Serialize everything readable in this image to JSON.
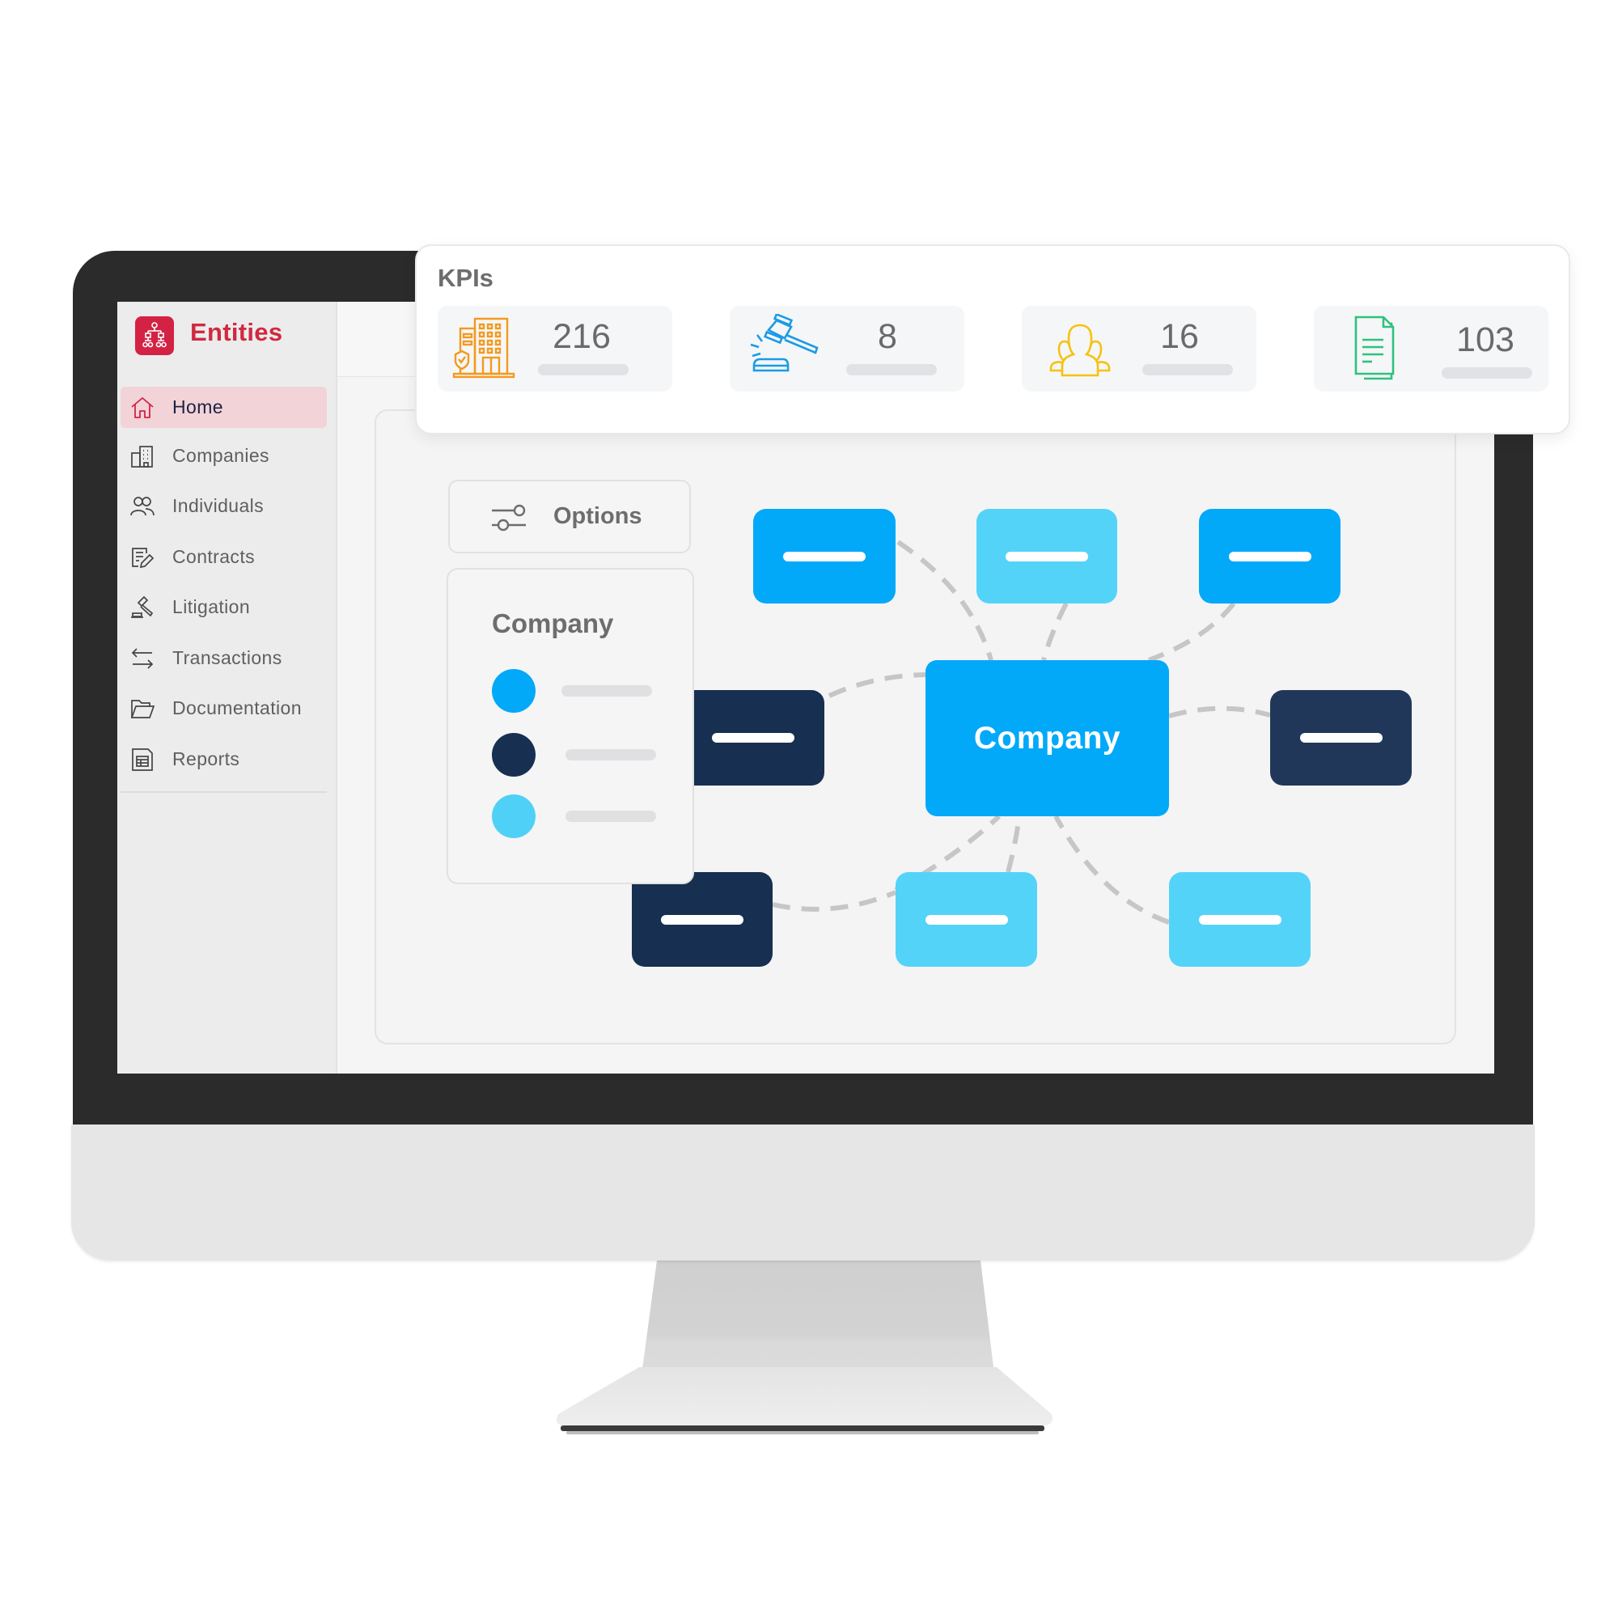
{
  "app": {
    "title": "Entities",
    "logo_icon": "org-chart-icon",
    "brand_color": "#d42244"
  },
  "sidebar": {
    "items": [
      {
        "label": "Home",
        "icon": "home-icon",
        "active": true
      },
      {
        "label": "Companies",
        "icon": "building-icon",
        "active": false
      },
      {
        "label": "Individuals",
        "icon": "users-icon",
        "active": false
      },
      {
        "label": "Contracts",
        "icon": "contract-edit-icon",
        "active": false
      },
      {
        "label": "Litigation",
        "icon": "gavel-icon",
        "active": false
      },
      {
        "label": "Transactions",
        "icon": "transfer-arrows-icon",
        "active": false
      },
      {
        "label": "Documentation",
        "icon": "folder-icon",
        "active": false
      },
      {
        "label": "Reports",
        "icon": "report-table-icon",
        "active": false
      }
    ]
  },
  "kpis": {
    "title": "KPIs",
    "cards": [
      {
        "value": "216",
        "icon": "building-shield-icon",
        "color": "#f39a1e"
      },
      {
        "value": "8",
        "icon": "gavel-icon",
        "color": "#1a9be6"
      },
      {
        "value": "16",
        "icon": "people-group-icon",
        "color": "#f5c211"
      },
      {
        "value": "103",
        "icon": "documents-icon",
        "color": "#2ec27e"
      }
    ]
  },
  "options": {
    "label": "Options",
    "icon": "sliders-icon"
  },
  "legend": {
    "title": "Company",
    "entries": [
      {
        "color": "#03a9f9"
      },
      {
        "color": "#172f50"
      },
      {
        "color": "#4fd1f7"
      }
    ]
  },
  "graph": {
    "center_label": "Company",
    "colors": {
      "blue": "#03a9f9",
      "navy": "#172f50",
      "navy_alt": "#21375a",
      "light": "#54d3f9"
    },
    "nodes": [
      {
        "id": "top-left",
        "type": "blue"
      },
      {
        "id": "top-center",
        "type": "light"
      },
      {
        "id": "top-right",
        "type": "blue"
      },
      {
        "id": "middle-left",
        "type": "navy"
      },
      {
        "id": "middle-right",
        "type": "navy_alt"
      },
      {
        "id": "bottom-left",
        "type": "navy"
      },
      {
        "id": "bottom-center",
        "type": "light"
      },
      {
        "id": "bottom-right",
        "type": "light"
      }
    ]
  }
}
